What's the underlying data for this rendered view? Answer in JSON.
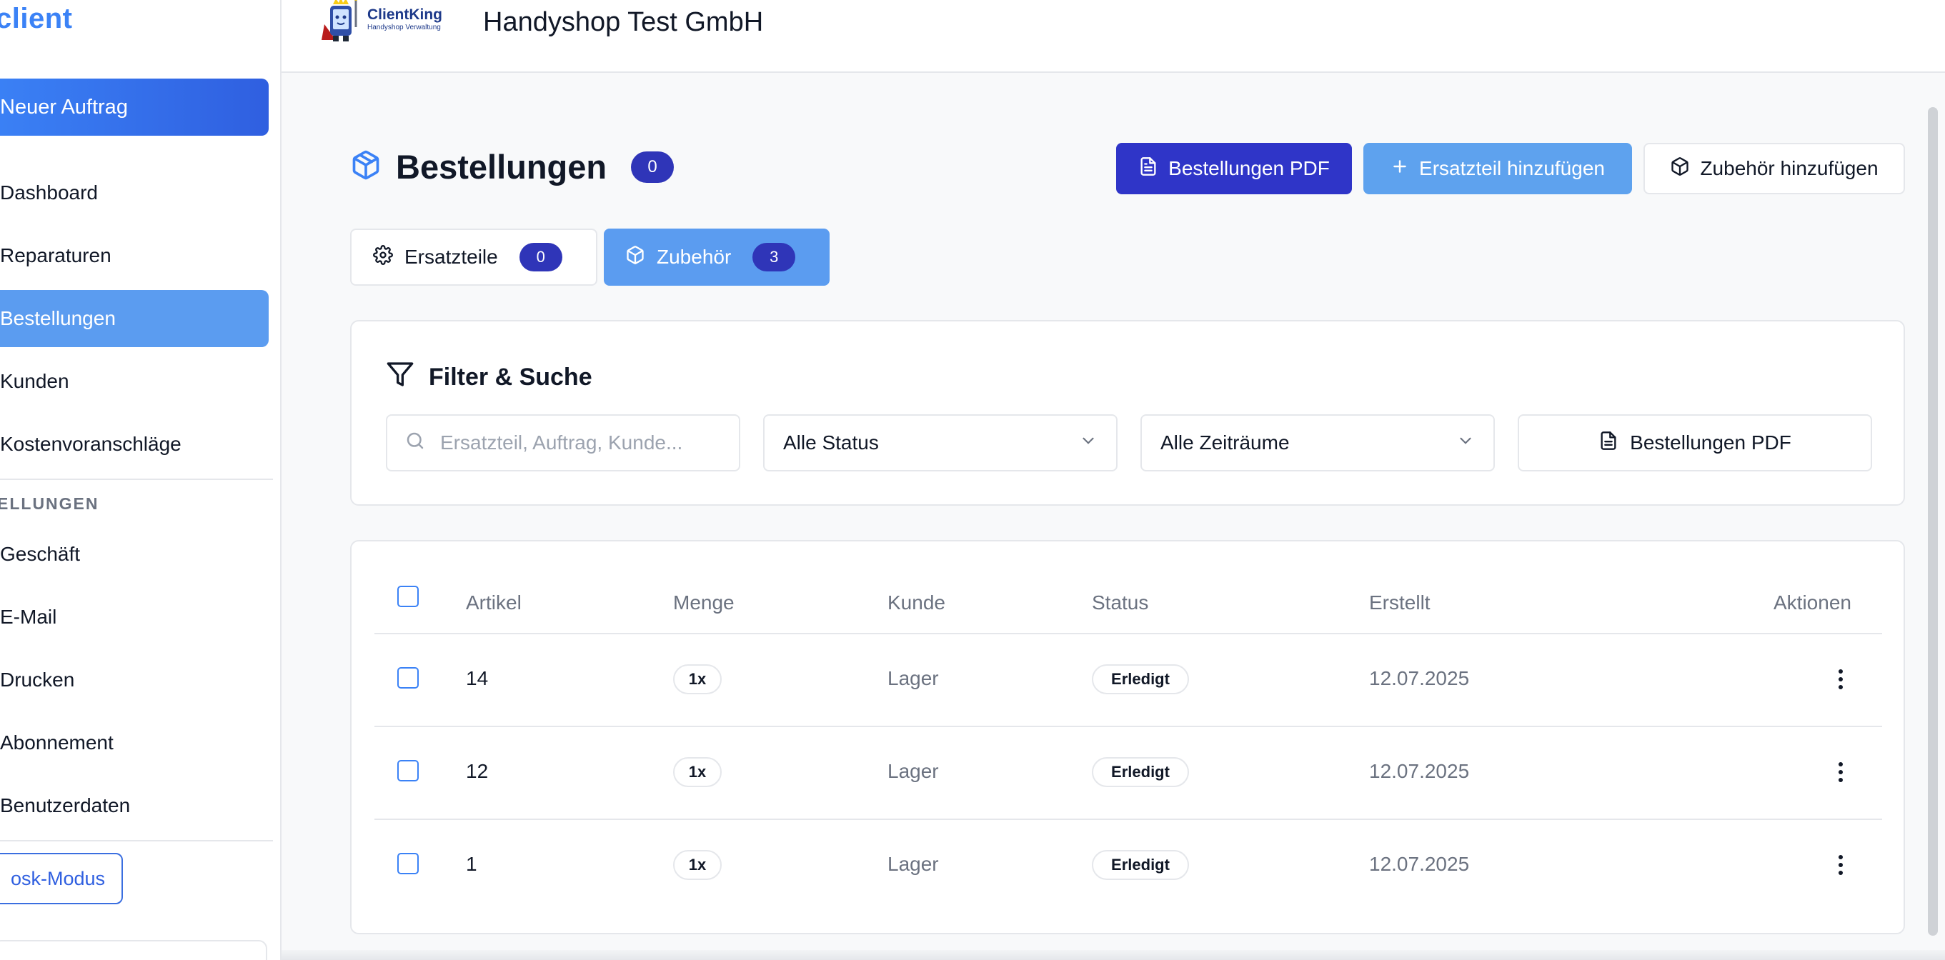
{
  "sidebar": {
    "brand": "client",
    "new_order": "Neuer Auftrag",
    "items": [
      {
        "label": "Dashboard"
      },
      {
        "label": "Reparaturen"
      },
      {
        "label": "Bestellungen"
      },
      {
        "label": "Kunden"
      },
      {
        "label": "Kostenvoranschläge"
      }
    ],
    "section_label": "ELLUNGEN",
    "settings_items": [
      {
        "label": "Geschäft"
      },
      {
        "label": "E-Mail"
      },
      {
        "label": "Drucken"
      },
      {
        "label": "Abonnement"
      },
      {
        "label": "Benutzerdaten"
      }
    ],
    "kiosk": "osk-Modus"
  },
  "header": {
    "logo_title": "ClientKing",
    "logo_sub": "Handyshop Verwaltung",
    "company": "Handyshop Test GmbH"
  },
  "page": {
    "title": "Bestellungen",
    "count": "0",
    "buttons": {
      "pdf": "Bestellungen PDF",
      "add_part": "Ersatzteil hinzufügen",
      "add_accessory": "Zubehör hinzufügen"
    },
    "tabs": [
      {
        "label": "Ersatzteile",
        "count": "0"
      },
      {
        "label": "Zubehör",
        "count": "3"
      }
    ]
  },
  "filter": {
    "title": "Filter & Suche",
    "search_placeholder": "Ersatzteil, Auftrag, Kunde...",
    "status_value": "Alle Status",
    "period_value": "Alle Zeiträume",
    "pdf_label": "Bestellungen PDF"
  },
  "table": {
    "headers": {
      "artikel": "Artikel",
      "menge": "Menge",
      "kunde": "Kunde",
      "status": "Status",
      "erstellt": "Erstellt",
      "aktionen": "Aktionen"
    },
    "rows": [
      {
        "artikel": "14",
        "menge": "1x",
        "kunde": "Lager",
        "status": "Erledigt",
        "erstellt": "12.07.2025"
      },
      {
        "artikel": "12",
        "menge": "1x",
        "kunde": "Lager",
        "status": "Erledigt",
        "erstellt": "12.07.2025"
      },
      {
        "artikel": "1",
        "menge": "1x",
        "kunde": "Lager",
        "status": "Erledigt",
        "erstellt": "12.07.2025"
      }
    ]
  },
  "colors": {
    "primary": "#2f35c8",
    "accent": "#5b9cf0",
    "brand_blue": "#3b82f6"
  }
}
